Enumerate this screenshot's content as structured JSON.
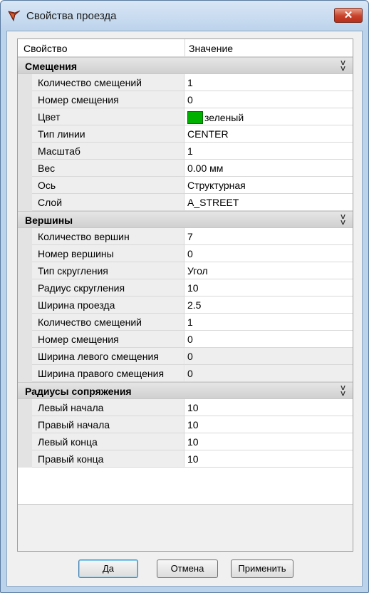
{
  "window": {
    "title": "Свойства проезда",
    "close_label": "✕"
  },
  "grid": {
    "header": {
      "property": "Свойство",
      "value": "Значение"
    },
    "sections": [
      {
        "title": "Смещения",
        "rows": [
          {
            "name": "Количество смещений",
            "value": "1"
          },
          {
            "name": "Номер смещения",
            "value": "0"
          },
          {
            "name": "Цвет",
            "value": "зеленый"
          },
          {
            "name": "Тип линии",
            "value": "CENTER"
          },
          {
            "name": "Масштаб",
            "value": "1"
          },
          {
            "name": "Вес",
            "value": "0.00 мм"
          },
          {
            "name": "Ось",
            "value": "Структурная"
          },
          {
            "name": "Слой",
            "value": "A_STREET"
          }
        ]
      },
      {
        "title": "Вершины",
        "rows": [
          {
            "name": "Количество вершин",
            "value": "7"
          },
          {
            "name": "Номер вершины",
            "value": "0"
          },
          {
            "name": "Тип скругления",
            "value": "Угол"
          },
          {
            "name": "Радиус скругления",
            "value": "10"
          },
          {
            "name": "Ширина проезда",
            "value": "2.5"
          },
          {
            "name": "Количество смещений",
            "value": "1"
          },
          {
            "name": "Номер смещения",
            "value": "0"
          },
          {
            "name": "Ширина левого смещения",
            "value": "0"
          },
          {
            "name": "Ширина правого смещения",
            "value": "0"
          }
        ]
      },
      {
        "title": "Радиусы сопряжения",
        "rows": [
          {
            "name": "Левый начала",
            "value": "10"
          },
          {
            "name": "Правый начала",
            "value": "10"
          },
          {
            "name": "Левый конца",
            "value": "10"
          },
          {
            "name": "Правый конца",
            "value": "10"
          }
        ]
      }
    ],
    "color_swatch": "#00b000"
  },
  "buttons": {
    "ok": "Да",
    "cancel": "Отмена",
    "apply": "Применить"
  }
}
